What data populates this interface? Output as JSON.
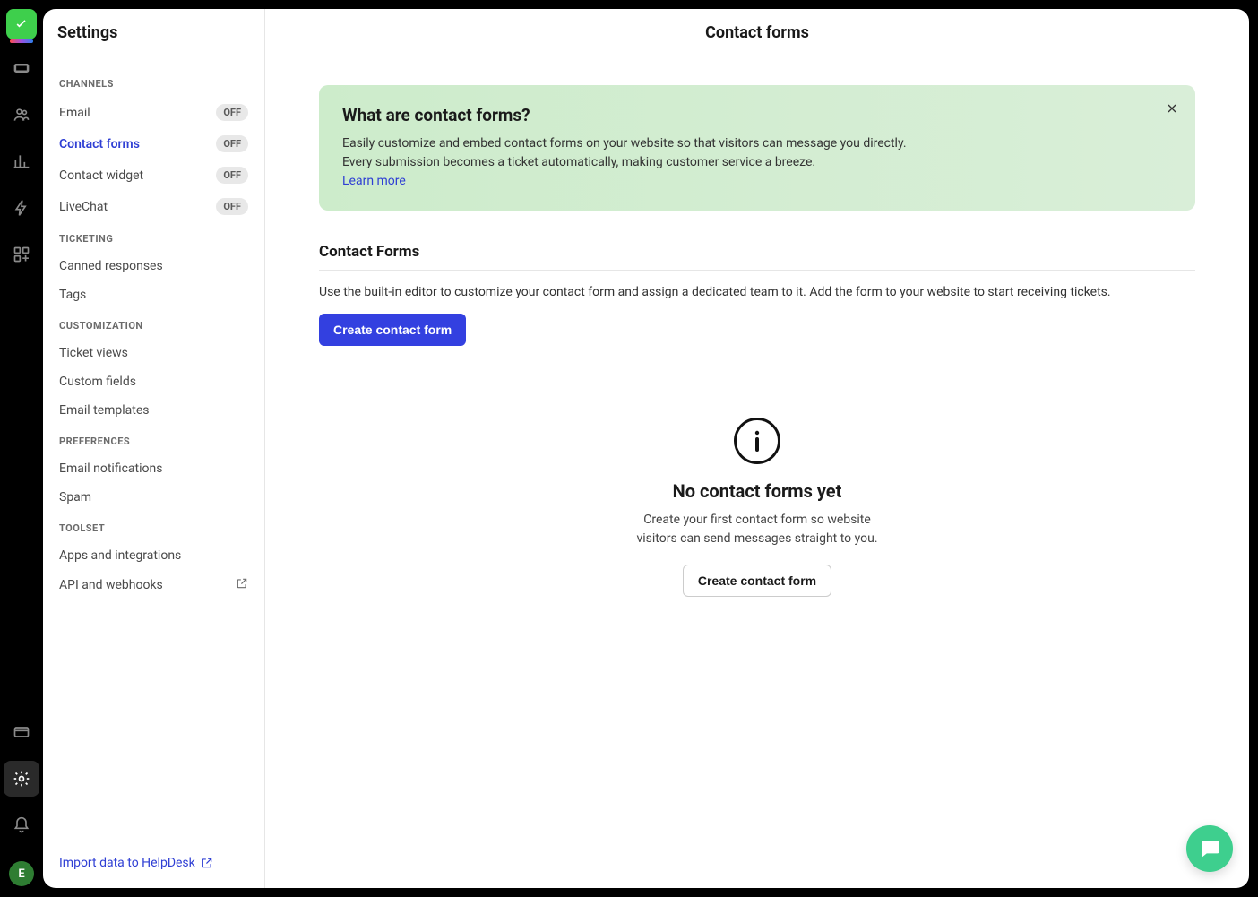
{
  "rail": {
    "avatar_initial": "E"
  },
  "header": {
    "left": "Settings",
    "main": "Contact forms"
  },
  "sidebar": {
    "sections": {
      "channels": {
        "label": "CHANNELS",
        "items": [
          {
            "label": "Email",
            "badge": "OFF"
          },
          {
            "label": "Contact forms",
            "badge": "OFF"
          },
          {
            "label": "Contact widget",
            "badge": "OFF"
          },
          {
            "label": "LiveChat",
            "badge": "OFF"
          }
        ]
      },
      "ticketing": {
        "label": "TICKETING",
        "items": [
          {
            "label": "Canned responses"
          },
          {
            "label": "Tags"
          }
        ]
      },
      "customization": {
        "label": "CUSTOMIZATION",
        "items": [
          {
            "label": "Ticket views"
          },
          {
            "label": "Custom fields"
          },
          {
            "label": "Email templates"
          }
        ]
      },
      "preferences": {
        "label": "PREFERENCES",
        "items": [
          {
            "label": "Email notifications"
          },
          {
            "label": "Spam"
          }
        ]
      },
      "toolset": {
        "label": "TOOLSET",
        "items": [
          {
            "label": "Apps and integrations"
          },
          {
            "label": "API and webhooks"
          }
        ]
      }
    },
    "import_link": "Import data to HelpDesk"
  },
  "banner": {
    "title": "What are contact forms?",
    "body": "Easily customize and embed contact forms on your website so that visitors can message you directly. Every submission becomes a ticket automatically, making customer service a breeze.",
    "learn_more": "Learn more"
  },
  "main": {
    "section_title": "Contact Forms",
    "section_desc": "Use the built-in editor to customize your contact form and assign a dedicated team to it. Add the form to your website to start receiving tickets.",
    "create_btn": "Create contact form"
  },
  "empty": {
    "title": "No contact forms yet",
    "desc": "Create your first contact form so website visitors can send messages straight to you.",
    "btn": "Create contact form"
  }
}
